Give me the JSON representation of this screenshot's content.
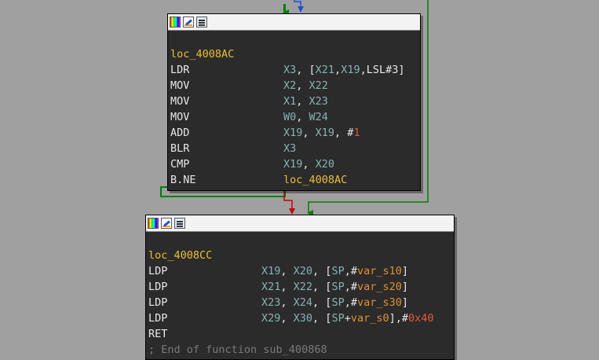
{
  "colors": {
    "background": "#a0a0a0",
    "block_bg": "#2b2b2b",
    "edge_true": "#008000",
    "edge_false": "#cc0000",
    "edge_uncond": "#1f4fd8",
    "label": "#e8c030",
    "register": "#86b3b3",
    "immediate": "#e05a3a",
    "variable": "#e0902a"
  },
  "toolbar_icons": [
    "set-node-color-icon",
    "rename-node-icon",
    "graph-overview-icon"
  ],
  "block1": {
    "label": "loc_4008AC",
    "lines": [
      {
        "mn": "LDR",
        "ops": [
          {
            "t": "X3",
            "c": "reg"
          },
          {
            "t": ", [",
            "c": ""
          },
          {
            "t": "X21",
            "c": "reg"
          },
          {
            "t": ",",
            "c": ""
          },
          {
            "t": "X19",
            "c": "reg"
          },
          {
            "t": ",LSL#3]",
            "c": ""
          }
        ]
      },
      {
        "mn": "MOV",
        "ops": [
          {
            "t": "X2",
            "c": "reg"
          },
          {
            "t": ", ",
            "c": ""
          },
          {
            "t": "X22",
            "c": "reg"
          }
        ]
      },
      {
        "mn": "MOV",
        "ops": [
          {
            "t": "X1",
            "c": "reg"
          },
          {
            "t": ", ",
            "c": ""
          },
          {
            "t": "X23",
            "c": "reg"
          }
        ]
      },
      {
        "mn": "MOV",
        "ops": [
          {
            "t": "W0",
            "c": "reg"
          },
          {
            "t": ", ",
            "c": ""
          },
          {
            "t": "W24",
            "c": "reg"
          }
        ]
      },
      {
        "mn": "ADD",
        "ops": [
          {
            "t": "X19",
            "c": "reg"
          },
          {
            "t": ", ",
            "c": ""
          },
          {
            "t": "X19",
            "c": "reg"
          },
          {
            "t": ", #",
            "c": ""
          },
          {
            "t": "1",
            "c": "imm"
          }
        ]
      },
      {
        "mn": "BLR",
        "ops": [
          {
            "t": "X3",
            "c": "reg"
          }
        ]
      },
      {
        "mn": "CMP",
        "ops": [
          {
            "t": "X19",
            "c": "reg"
          },
          {
            "t": ", ",
            "c": ""
          },
          {
            "t": "X20",
            "c": "reg"
          }
        ]
      },
      {
        "mn": "B.NE",
        "ops": [
          {
            "t": "loc_4008AC",
            "c": "loc"
          }
        ]
      }
    ]
  },
  "block2": {
    "label": "loc_4008CC",
    "lines": [
      {
        "mn": "LDP",
        "ops": [
          {
            "t": "X19",
            "c": "reg"
          },
          {
            "t": ", ",
            "c": ""
          },
          {
            "t": "X20",
            "c": "reg"
          },
          {
            "t": ", [",
            "c": ""
          },
          {
            "t": "SP",
            "c": "reg"
          },
          {
            "t": ",#",
            "c": ""
          },
          {
            "t": "var_s10",
            "c": "var"
          },
          {
            "t": "]",
            "c": ""
          }
        ]
      },
      {
        "mn": "LDP",
        "ops": [
          {
            "t": "X21",
            "c": "reg"
          },
          {
            "t": ", ",
            "c": ""
          },
          {
            "t": "X22",
            "c": "reg"
          },
          {
            "t": ", [",
            "c": ""
          },
          {
            "t": "SP",
            "c": "reg"
          },
          {
            "t": ",#",
            "c": ""
          },
          {
            "t": "var_s20",
            "c": "var"
          },
          {
            "t": "]",
            "c": ""
          }
        ]
      },
      {
        "mn": "LDP",
        "ops": [
          {
            "t": "X23",
            "c": "reg"
          },
          {
            "t": ", ",
            "c": ""
          },
          {
            "t": "X24",
            "c": "reg"
          },
          {
            "t": ", [",
            "c": ""
          },
          {
            "t": "SP",
            "c": "reg"
          },
          {
            "t": ",#",
            "c": ""
          },
          {
            "t": "var_s30",
            "c": "var"
          },
          {
            "t": "]",
            "c": ""
          }
        ]
      },
      {
        "mn": "LDP",
        "ops": [
          {
            "t": "X29",
            "c": "reg"
          },
          {
            "t": ", ",
            "c": ""
          },
          {
            "t": "X30",
            "c": "reg"
          },
          {
            "t": ", [",
            "c": ""
          },
          {
            "t": "SP",
            "c": "reg"
          },
          {
            "t": "+",
            "c": ""
          },
          {
            "t": "var_s0",
            "c": "var"
          },
          {
            "t": "],#",
            "c": ""
          },
          {
            "t": "0x40",
            "c": "imm"
          }
        ]
      },
      {
        "mn": "RET",
        "ops": []
      }
    ],
    "comment": "; End of function sub_400868"
  }
}
